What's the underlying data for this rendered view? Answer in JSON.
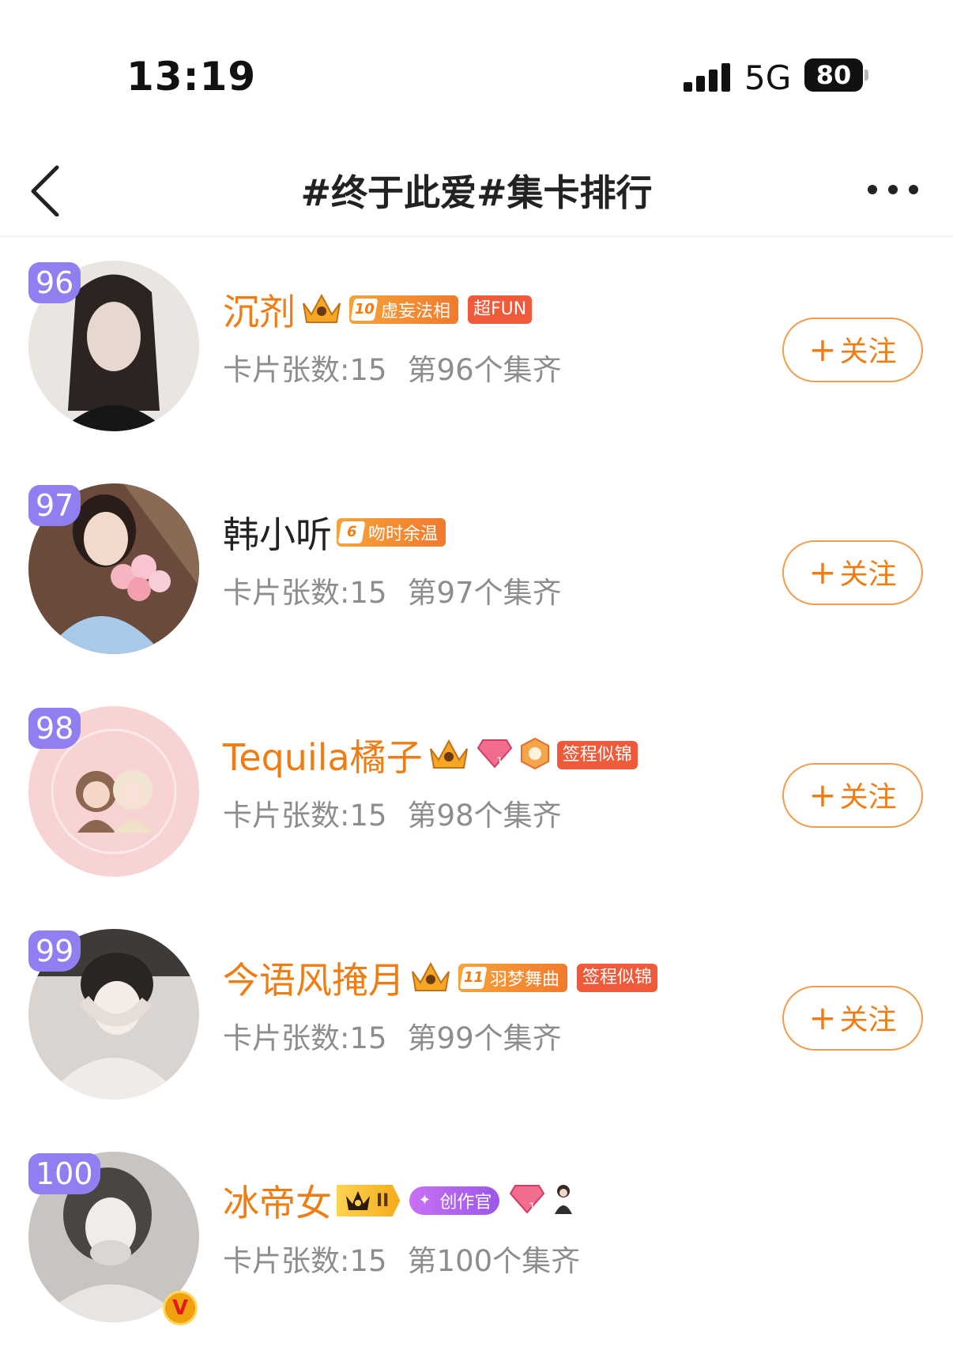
{
  "status_bar": {
    "time": "13:19",
    "network": "5G",
    "battery": "80"
  },
  "header": {
    "title": "#终于此爱#集卡排行",
    "back_icon": "chevron-left-icon",
    "more_icon": "more-dots-icon"
  },
  "colors": {
    "accent": "#f07c14",
    "rank_badge": "#8f7ff0",
    "stats_text": "#8d8d8d",
    "follow_border": "#f29b4a"
  },
  "rows": [
    {
      "rank": "96",
      "name": "沉剂",
      "name_color": "#f07c14",
      "badges": [
        {
          "kind": "crown-icon",
          "text": ""
        },
        {
          "kind": "orange-tag",
          "level": "10",
          "text": "虚妄法相"
        },
        {
          "kind": "red-tag",
          "text": "超FUN"
        }
      ],
      "cards_label": "卡片张数:15",
      "position_label": "第96个集齐",
      "follow_label": "关注"
    },
    {
      "rank": "97",
      "name": "韩小听",
      "name_color": "#222222",
      "badges": [
        {
          "kind": "orange-tag",
          "level": "6",
          "text": "吻时余温"
        }
      ],
      "cards_label": "卡片张数:15",
      "position_label": "第97个集齐",
      "follow_label": "关注"
    },
    {
      "rank": "98",
      "name": "Tequila橘子",
      "name_color": "#f07c14",
      "badges": [
        {
          "kind": "crown-icon",
          "text": ""
        },
        {
          "kind": "diamond-icon",
          "text": "12"
        },
        {
          "kind": "hexagon-icon",
          "text": ""
        },
        {
          "kind": "red-tag",
          "text": "签程似锦"
        }
      ],
      "cards_label": "卡片张数:15",
      "position_label": "第98个集齐",
      "follow_label": "关注"
    },
    {
      "rank": "99",
      "name": "今语风掩月",
      "name_color": "#f07c14",
      "badges": [
        {
          "kind": "crown-icon",
          "text": ""
        },
        {
          "kind": "orange-tag",
          "level": "11",
          "text": "羽梦舞曲"
        },
        {
          "kind": "red-tag",
          "text": "签程似锦"
        }
      ],
      "cards_label": "卡片张数:15",
      "position_label": "第99个集齐",
      "follow_label": "关注"
    },
    {
      "rank": "100",
      "name": "冰帝女",
      "name_color": "#f07c14",
      "verified": "V",
      "badges": [
        {
          "kind": "gold-tag",
          "text": "II"
        },
        {
          "kind": "purple-tag",
          "text": "创作官"
        },
        {
          "kind": "diamond-icon",
          "text": "14"
        },
        {
          "kind": "figure-icon",
          "text": ""
        }
      ],
      "cards_label": "卡片张数:15",
      "position_label": "第100个集齐"
    }
  ]
}
